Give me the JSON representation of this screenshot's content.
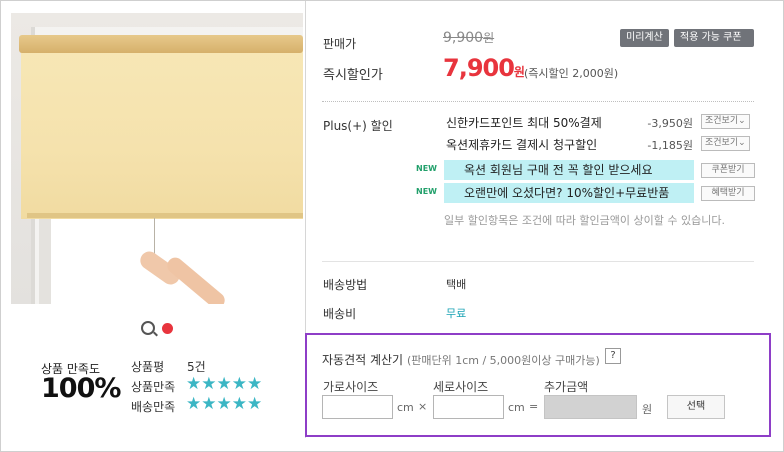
{
  "product": {
    "image_alt": "roller blind",
    "gallery_icon": "search-icon",
    "gallery_dot_color": "#e8343d"
  },
  "satisfaction": {
    "label": "상품 만족도",
    "percent": "100%",
    "reviews_label": "상품평",
    "reviews_count": "5건",
    "product_sat_label": "상품만족",
    "product_sat_stars": "★★★★★",
    "shipping_sat_label": "배송만족",
    "shipping_sat_stars": "★★★★★",
    "star_color": "#3bb6c4"
  },
  "price": {
    "list_label": "판매가",
    "list_value": "9,900",
    "list_unit": "원",
    "preview_button": "미리계산",
    "coupon_button": "적용 가능 쿠폰",
    "instant_label": "즉시할인가",
    "sale_value": "7,900",
    "sale_unit": "원",
    "sale_note": "(즉시할인 2,000원)",
    "sale_color": "#e8343d"
  },
  "plus_discount": {
    "label": "Plus(+) 할인",
    "cards": [
      {
        "name": "신한카드포인트 최대 50%결제",
        "amount": "-3,950원",
        "button": "조건보기"
      },
      {
        "name": "옥션제휴카드 결제시 청구할인",
        "amount": "-1,185원",
        "button": "조건보기"
      }
    ],
    "banners": [
      {
        "tag": "NEW",
        "text": "옥션 회원님 구매 전 꼭 할인 받으세요",
        "button": "쿠폰받기"
      },
      {
        "tag": "NEW",
        "text": "오랜만에 오셨다면? 10%할인+무료반품",
        "button": "혜택받기"
      }
    ],
    "notice": "일부 할인항목은 조건에 따라 할인금액이 상이할 수 있습니다."
  },
  "shipping": {
    "method_label": "배송방법",
    "method_value": "택배",
    "fee_label": "배송비",
    "fee_value": "무료",
    "fee_color": "#1aa3b4"
  },
  "calculator": {
    "title": "자동견적 계산기",
    "title_note": "(판매단위 1cm / 5,000원이상 구매가능)",
    "help": "?",
    "width_label": "가로사이즈",
    "height_label": "세로사이즈",
    "extra_label": "추가금액",
    "width_value": "",
    "height_value": "",
    "extra_value": "",
    "unit_cm": "cm",
    "times": "×",
    "equals": "=",
    "unit_won": "원",
    "select_button": "선택",
    "box_color": "#8e3ec7"
  }
}
